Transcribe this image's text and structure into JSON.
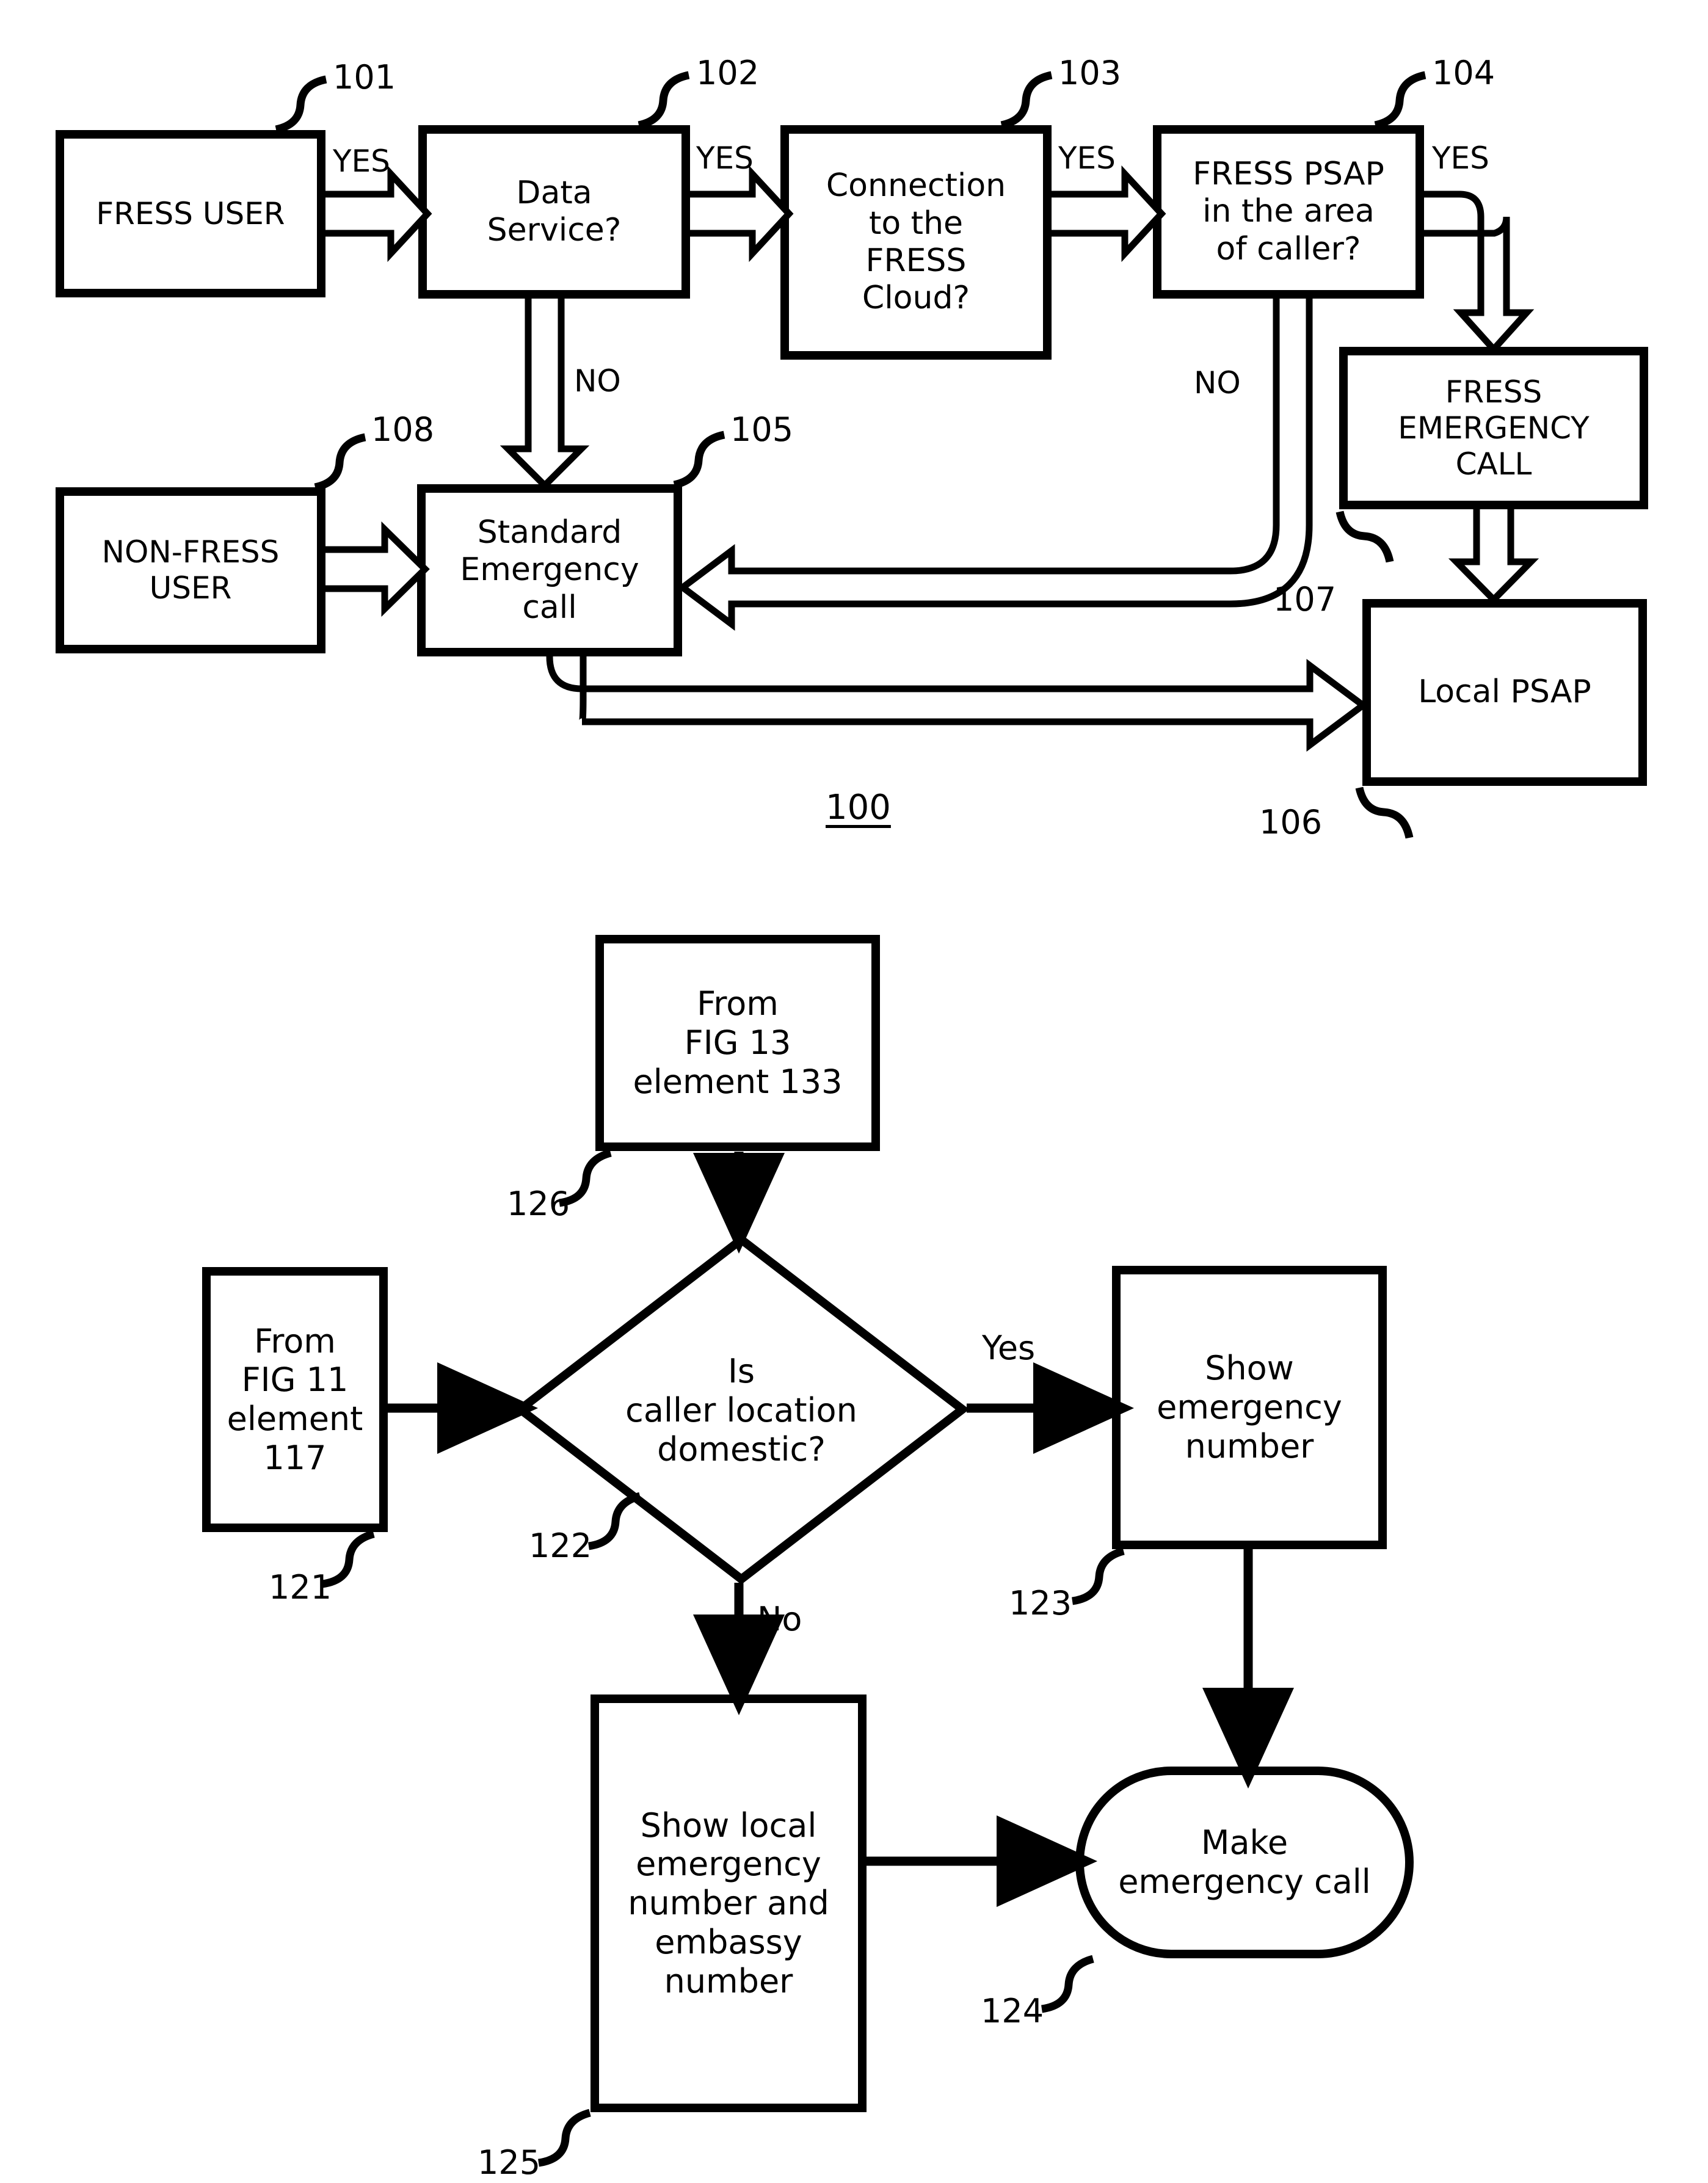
{
  "figures": [
    {
      "id": "fig-top",
      "figure_label": "100",
      "nodes": [
        {
          "key": "fress_user",
          "label": "FRESS USER",
          "ref": "101",
          "shape": "rect"
        },
        {
          "key": "data_service",
          "label": "Data\nService?",
          "ref": "102",
          "shape": "rect"
        },
        {
          "key": "connection_cloud",
          "label": "Connection\nto the\nFRESS\nCloud?",
          "ref": "103",
          "shape": "rect"
        },
        {
          "key": "fress_psap_area",
          "label": "FRESS PSAP\nin the area\nof caller?",
          "ref": "104",
          "shape": "rect"
        },
        {
          "key": "standard_call",
          "label": "Standard\nEmergency\ncall",
          "ref": "105",
          "shape": "rect"
        },
        {
          "key": "local_psap",
          "label": "Local PSAP",
          "ref": "106",
          "shape": "rect"
        },
        {
          "key": "fress_emerg_call",
          "label": "FRESS\nEMERGENCY\nCALL",
          "ref": "107",
          "shape": "rect"
        },
        {
          "key": "non_fress_user",
          "label": "NON-FRESS\nUSER",
          "ref": "108",
          "shape": "rect"
        }
      ],
      "edge_labels": [
        {
          "key": "yes1",
          "text": "YES"
        },
        {
          "key": "yes2",
          "text": "YES"
        },
        {
          "key": "yes3",
          "text": "YES"
        },
        {
          "key": "yes4",
          "text": "YES"
        },
        {
          "key": "no_data_service",
          "text": "NO"
        },
        {
          "key": "no_psap_area",
          "text": "NO"
        }
      ]
    },
    {
      "id": "fig-bottom",
      "nodes": [
        {
          "key": "from_fig13",
          "label": "From\nFIG 13\nelement 133",
          "ref": "126",
          "shape": "rect"
        },
        {
          "key": "from_fig11",
          "label": "From\nFIG 11\nelement\n117",
          "ref": "121",
          "shape": "rect"
        },
        {
          "key": "is_domestic",
          "label": "Is\ncaller location\ndomestic?",
          "ref": "122",
          "shape": "diamond"
        },
        {
          "key": "show_emerg",
          "label": "Show\nemergency\nnumber",
          "ref": "123",
          "shape": "rect"
        },
        {
          "key": "show_local",
          "label": "Show local\nemergency\nnumber and\nembassy\nnumber",
          "ref": "125",
          "shape": "rect"
        },
        {
          "key": "make_call",
          "label": "Make\nemergency call",
          "ref": "124",
          "shape": "stadium"
        }
      ],
      "edge_labels": [
        {
          "key": "yes_domestic",
          "text": "Yes"
        },
        {
          "key": "no_domestic",
          "text": "No"
        }
      ]
    }
  ],
  "colors": {
    "ink": "#000000",
    "paper": "#ffffff"
  }
}
